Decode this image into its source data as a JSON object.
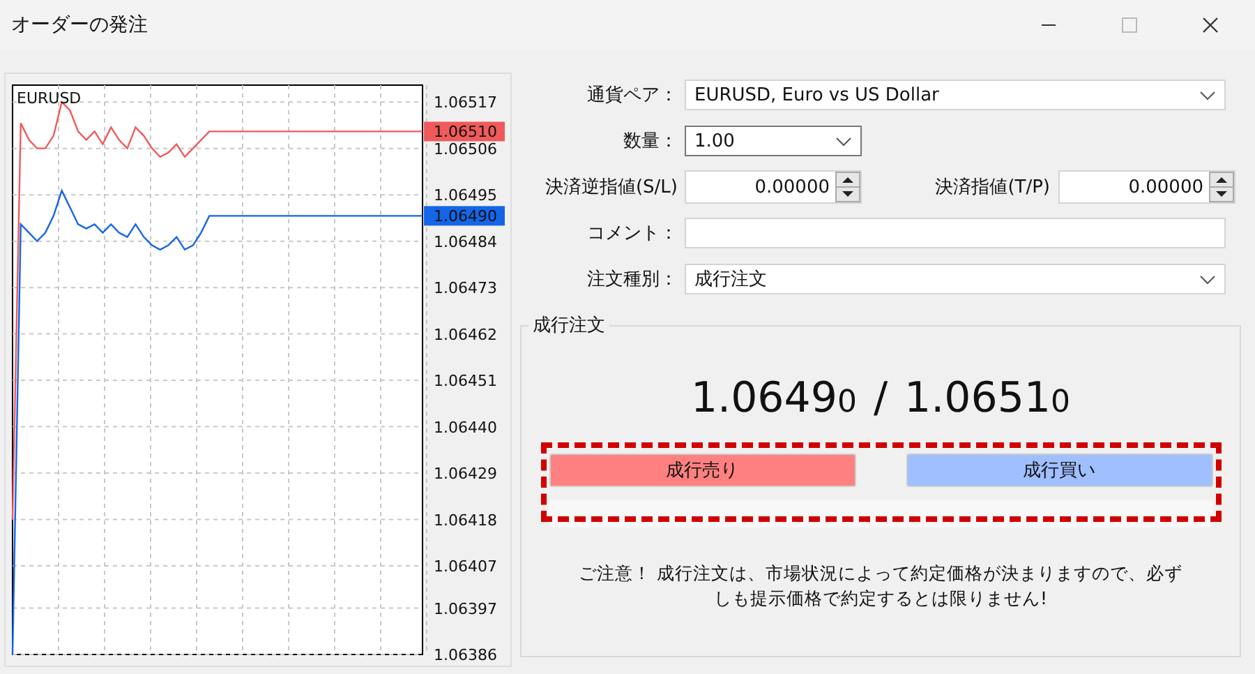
{
  "window": {
    "title": "オーダーの発注"
  },
  "chart": {
    "symbol": "EURUSD",
    "price_tags": [
      {
        "label": "1.06510",
        "color": "#f05a5a"
      },
      {
        "label": "1.06490",
        "color": "#1565e8"
      }
    ],
    "chart_data": {
      "type": "line",
      "grid": true,
      "categories": [
        null,
        null,
        null,
        null,
        null,
        null,
        null,
        null,
        null,
        null,
        null,
        null,
        null,
        null,
        null,
        null,
        null,
        null,
        null,
        null,
        null,
        null,
        null,
        null,
        null,
        null,
        null,
        null,
        null,
        null,
        null,
        null,
        null,
        null,
        null,
        null,
        null,
        null,
        null,
        null,
        null,
        null,
        null,
        null,
        null,
        null,
        null,
        null,
        null,
        null,
        null
      ],
      "ylim": [
        1.06386,
        1.06521
      ],
      "yticks": [
        {
          "value": 1.06517,
          "label": "1.06517"
        },
        {
          "value": 1.06506,
          "label": "1.06506"
        },
        {
          "value": 1.06495,
          "label": "1.06495"
        },
        {
          "value": 1.06484,
          "label": "1.06484"
        },
        {
          "value": 1.06473,
          "label": "1.06473"
        },
        {
          "value": 1.06462,
          "label": "1.06462"
        },
        {
          "value": 1.06451,
          "label": "1.06451"
        },
        {
          "value": 1.0644,
          "label": "1.06440"
        },
        {
          "value": 1.06429,
          "label": "1.06429"
        },
        {
          "value": 1.06418,
          "label": "1.06418"
        },
        {
          "value": 1.06407,
          "label": "1.06407"
        },
        {
          "value": 1.06397,
          "label": "1.06397"
        },
        {
          "value": 1.06386,
          "label": "1.06386"
        }
      ],
      "series": [
        {
          "color": "#f05a5a",
          "values": [
            1.06418,
            1.06512,
            1.06508,
            1.06506,
            1.06506,
            1.06509,
            1.06517,
            1.06515,
            1.0651,
            1.06508,
            1.0651,
            1.06507,
            1.06511,
            1.06508,
            1.06506,
            1.06511,
            1.06509,
            1.06506,
            1.06504,
            1.06505,
            1.06507,
            1.06504,
            1.06506,
            1.06508,
            1.0651,
            1.0651,
            1.0651,
            1.0651,
            1.0651,
            1.0651,
            1.0651,
            1.0651,
            1.0651,
            1.0651,
            1.0651,
            1.0651,
            1.0651,
            1.0651,
            1.0651,
            1.0651,
            1.0651,
            1.0651,
            1.0651,
            1.0651,
            1.0651,
            1.0651,
            1.0651,
            1.0651,
            1.0651,
            1.0651,
            1.0651
          ]
        },
        {
          "color": "#1565e8",
          "values": [
            1.06386,
            1.06488,
            1.06486,
            1.06484,
            1.06486,
            1.0649,
            1.06496,
            1.06492,
            1.06488,
            1.06487,
            1.06488,
            1.06486,
            1.06488,
            1.06486,
            1.06485,
            1.06488,
            1.06485,
            1.06483,
            1.06482,
            1.06483,
            1.06485,
            1.06482,
            1.06483,
            1.06486,
            1.0649,
            1.0649,
            1.0649,
            1.0649,
            1.0649,
            1.0649,
            1.0649,
            1.0649,
            1.0649,
            1.0649,
            1.0649,
            1.0649,
            1.0649,
            1.0649,
            1.0649,
            1.0649,
            1.0649,
            1.0649,
            1.0649,
            1.0649,
            1.0649,
            1.0649,
            1.0649,
            1.0649,
            1.0649,
            1.0649,
            1.0649
          ]
        }
      ]
    }
  },
  "form": {
    "currency_pair": {
      "label": "通貨ペア：",
      "value": "EURUSD, Euro vs US Dollar"
    },
    "volume": {
      "label": "数量：",
      "value": "1.00",
      "focused": true
    },
    "stop_loss": {
      "label": "決済逆指値(S/L)",
      "value": "0.00000"
    },
    "take_profit": {
      "label": "決済指値(T/P)",
      "value": "0.00000"
    },
    "comment": {
      "label": "コメント："
    },
    "order_type": {
      "label": "注文種別：",
      "value": "成行注文"
    }
  },
  "market": {
    "title": "成行注文",
    "bid": {
      "main": "1.0649",
      "small": "0"
    },
    "separator": "/",
    "ask": {
      "main": "1.0651",
      "small": "0"
    },
    "highlighted": true,
    "buttons": [
      {
        "label": "成行売り",
        "color": "#ff8080"
      },
      {
        "label": "成行買い",
        "color": "#a0bfff"
      }
    ],
    "notice": "ご注意！ 成行注文は、市場状況によって約定価格が決まりますので、必ずしも提示価格で約定するとは限りません!"
  }
}
